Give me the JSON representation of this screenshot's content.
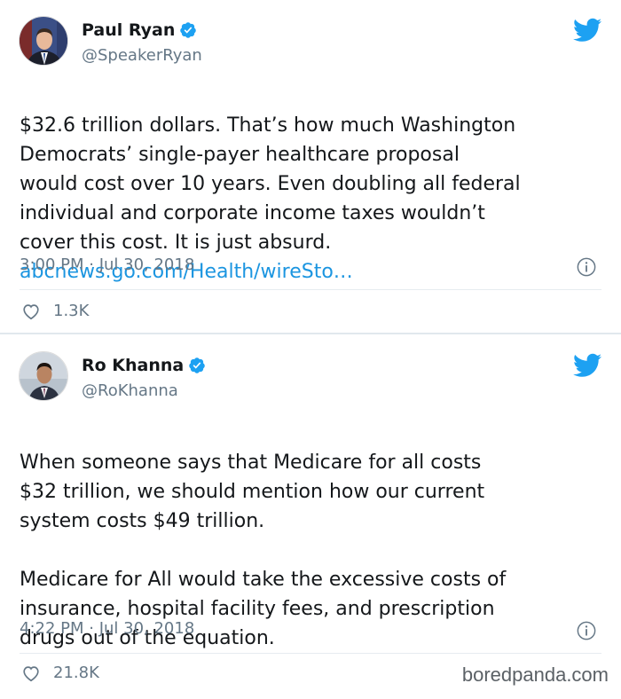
{
  "tweets": [
    {
      "author": "Paul Ryan",
      "handle": "@SpeakerRyan",
      "text": "$32.6 trillion dollars. That’s how much Washington\nDemocrats’ single-payer healthcare proposal\nwould cost over 10 years. Even doubling all federal\nindividual and corporate income taxes wouldn’t\ncover this cost. It is just absurd.",
      "link": "abcnews.go.com/Health/wireSto…",
      "timestamp": "3:00 PM · Jul 30, 2018",
      "likes": "1.3K",
      "avatar_icon": "man-in-suit-portrait"
    },
    {
      "author": "Ro Khanna",
      "handle": "@RoKhanna",
      "text": "When someone says that Medicare for all costs\n$32 trillion, we should mention how our current\nsystem costs $49 trillion.\n\nMedicare for All would take the excessive costs of\ninsurance, hospital facility fees, and prescription\ndrugs out of the equation.",
      "timestamp": "4:22 PM · Jul 30, 2018",
      "likes": "21.8K",
      "avatar_icon": "man-in-suit-portrait"
    }
  ],
  "icons": {
    "verified": "verified-badge-icon",
    "bird": "twitter-bird-icon",
    "info": "info-icon",
    "like": "heart-icon"
  },
  "colors": {
    "twitter_blue": "#1da1f2",
    "link": "#1b95e0",
    "secondary_text": "#657786"
  },
  "watermark": "boredpanda.com"
}
